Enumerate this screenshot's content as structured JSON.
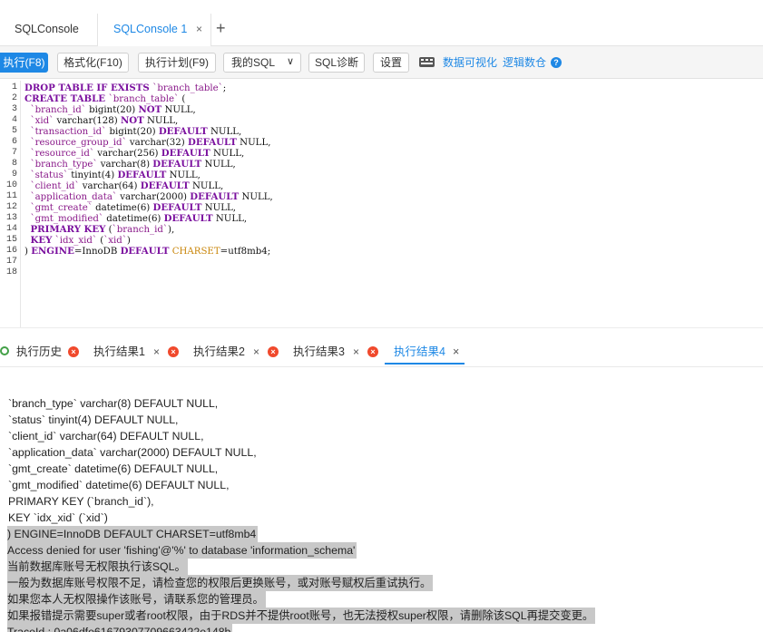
{
  "tabs": {
    "items": [
      {
        "label": "SQLConsole"
      },
      {
        "label": "SQLConsole 1",
        "close": "×"
      }
    ],
    "add": "+"
  },
  "toolbar": {
    "run": "执行(F8)",
    "format": "格式化(F10)",
    "plan": "执行计划(F9)",
    "my_sql": "我的SQL",
    "my_sql_chevron": "∨",
    "diagnose": "SQL诊断",
    "settings": "设置",
    "visualize": "数据可视化",
    "logic_warehouse": "逻辑数仓",
    "help": "?"
  },
  "editor": {
    "line_numbers": [
      "1",
      "2",
      "3",
      "4",
      "5",
      "6",
      "7",
      "8",
      "9",
      "10",
      "11",
      "12",
      "13",
      "14",
      "15",
      "16",
      "17",
      "18"
    ],
    "lines": [
      [
        {
          "t": "DROP TABLE IF EXISTS ",
          "c": "kw"
        },
        {
          "t": "`branch_table`",
          "c": "st"
        },
        {
          "t": ";",
          "c": ""
        }
      ],
      [
        {
          "t": "CREATE TABLE ",
          "c": "kw"
        },
        {
          "t": "`branch_table`",
          "c": "st"
        },
        {
          "t": " (",
          "c": ""
        }
      ],
      [
        {
          "t": "  ",
          "c": ""
        },
        {
          "t": "`branch_id`",
          "c": "st"
        },
        {
          "t": " bigint(20) ",
          "c": ""
        },
        {
          "t": "NOT",
          "c": "kw"
        },
        {
          "t": " NULL,",
          "c": ""
        }
      ],
      [
        {
          "t": "  ",
          "c": ""
        },
        {
          "t": "`xid`",
          "c": "st"
        },
        {
          "t": " varchar(128) ",
          "c": ""
        },
        {
          "t": "NOT",
          "c": "kw"
        },
        {
          "t": " NULL,",
          "c": ""
        }
      ],
      [
        {
          "t": "  ",
          "c": ""
        },
        {
          "t": "`transaction_id`",
          "c": "st"
        },
        {
          "t": " bigint(20) ",
          "c": ""
        },
        {
          "t": "DEFAULT",
          "c": "kw"
        },
        {
          "t": " NULL,",
          "c": ""
        }
      ],
      [
        {
          "t": "  ",
          "c": ""
        },
        {
          "t": "`resource_group_id`",
          "c": "st"
        },
        {
          "t": " varchar(32) ",
          "c": ""
        },
        {
          "t": "DEFAULT",
          "c": "kw"
        },
        {
          "t": " NULL,",
          "c": ""
        }
      ],
      [
        {
          "t": "  ",
          "c": ""
        },
        {
          "t": "`resource_id`",
          "c": "st"
        },
        {
          "t": " varchar(256) ",
          "c": ""
        },
        {
          "t": "DEFAULT",
          "c": "kw"
        },
        {
          "t": " NULL,",
          "c": ""
        }
      ],
      [
        {
          "t": "  ",
          "c": ""
        },
        {
          "t": "`branch_type`",
          "c": "st"
        },
        {
          "t": " varchar(8) ",
          "c": ""
        },
        {
          "t": "DEFAULT",
          "c": "kw"
        },
        {
          "t": " NULL,",
          "c": ""
        }
      ],
      [
        {
          "t": "  ",
          "c": ""
        },
        {
          "t": "`status`",
          "c": "st"
        },
        {
          "t": " tinyint(4) ",
          "c": ""
        },
        {
          "t": "DEFAULT",
          "c": "kw"
        },
        {
          "t": " NULL,",
          "c": ""
        }
      ],
      [
        {
          "t": "  ",
          "c": ""
        },
        {
          "t": "`client_id`",
          "c": "st"
        },
        {
          "t": " varchar(64) ",
          "c": ""
        },
        {
          "t": "DEFAULT",
          "c": "kw"
        },
        {
          "t": " NULL,",
          "c": ""
        }
      ],
      [
        {
          "t": "  ",
          "c": ""
        },
        {
          "t": "`application_data`",
          "c": "st"
        },
        {
          "t": " varchar(2000) ",
          "c": ""
        },
        {
          "t": "DEFAULT",
          "c": "kw"
        },
        {
          "t": " NULL,",
          "c": ""
        }
      ],
      [
        {
          "t": "  ",
          "c": ""
        },
        {
          "t": "`gmt_create`",
          "c": "st"
        },
        {
          "t": " datetime(6) ",
          "c": ""
        },
        {
          "t": "DEFAULT",
          "c": "kw"
        },
        {
          "t": " NULL,",
          "c": ""
        }
      ],
      [
        {
          "t": "  ",
          "c": ""
        },
        {
          "t": "`gmt_modified`",
          "c": "st"
        },
        {
          "t": " datetime(6) ",
          "c": ""
        },
        {
          "t": "DEFAULT",
          "c": "kw"
        },
        {
          "t": " NULL,",
          "c": ""
        }
      ],
      [
        {
          "t": "  ",
          "c": ""
        },
        {
          "t": "PRIMARY KEY",
          "c": "kw"
        },
        {
          "t": " (",
          "c": ""
        },
        {
          "t": "`branch_id`",
          "c": "st"
        },
        {
          "t": "),",
          "c": ""
        }
      ],
      [
        {
          "t": "  ",
          "c": ""
        },
        {
          "t": "KEY",
          "c": "kw"
        },
        {
          "t": " ",
          "c": ""
        },
        {
          "t": "`idx_xid`",
          "c": "st"
        },
        {
          "t": " (",
          "c": ""
        },
        {
          "t": "`xid`",
          "c": "st"
        },
        {
          "t": ")",
          "c": ""
        }
      ],
      [
        {
          "t": ") ",
          "c": ""
        },
        {
          "t": "ENGINE",
          "c": "kw"
        },
        {
          "t": "=InnoDB ",
          "c": ""
        },
        {
          "t": "DEFAULT",
          "c": "kw"
        },
        {
          "t": " ",
          "c": ""
        },
        {
          "t": "CHARSET",
          "c": "cs"
        },
        {
          "t": "=utf8mb4;",
          "c": ""
        }
      ],
      [],
      []
    ]
  },
  "result_tabs": {
    "history": "执行历史",
    "results": [
      "执行结果1",
      "执行结果2",
      "执行结果3",
      "执行结果4"
    ],
    "close_plain": "×",
    "close_circle": "×"
  },
  "output": {
    "lines": [
      {
        "text": "`branch_type` varchar(8) DEFAULT NULL,",
        "selected": false
      },
      {
        "text": "`status` tinyint(4) DEFAULT NULL,",
        "selected": false
      },
      {
        "text": "`client_id` varchar(64) DEFAULT NULL,",
        "selected": false
      },
      {
        "text": "`application_data` varchar(2000) DEFAULT NULL,",
        "selected": false
      },
      {
        "text": "`gmt_create` datetime(6) DEFAULT NULL,",
        "selected": false
      },
      {
        "text": "`gmt_modified` datetime(6) DEFAULT NULL,",
        "selected": false
      },
      {
        "text": "PRIMARY KEY (`branch_id`),",
        "selected": false
      },
      {
        "text": "KEY `idx_xid` (`xid`)",
        "selected": false
      },
      {
        "text": ") ENGINE=InnoDB DEFAULT CHARSET=utf8mb4",
        "selected": true
      },
      {
        "text": "Access denied for user 'fishing'@'%' to database 'information_schema'",
        "selected": true
      },
      {
        "text": "当前数据库账号无权限执行该SQL。",
        "selected": true
      },
      {
        "text": "一般为数据库账号权限不足，请检查您的权限后更换账号，或对账号赋权后重试执行。",
        "selected": true
      },
      {
        "text": "如果您本人无权限操作该账号，请联系您的管理员。",
        "selected": true
      },
      {
        "text": "如果报错提示需要super或者root权限，由于RDS并不提供root账号，也无法授权super权限，请删除该SQL再提交变更。",
        "selected": true
      },
      {
        "text": "TraceId : 0a06dfe61679307709663422e148b",
        "selected": true
      }
    ]
  },
  "colors": {
    "accent": "#1e88e5",
    "keyword": "#7a0f9e",
    "string": "#8a1a8a",
    "charset": "#c9860b",
    "error": "#f0492c",
    "history": "#43a047",
    "selection": "#c8c8c8"
  }
}
